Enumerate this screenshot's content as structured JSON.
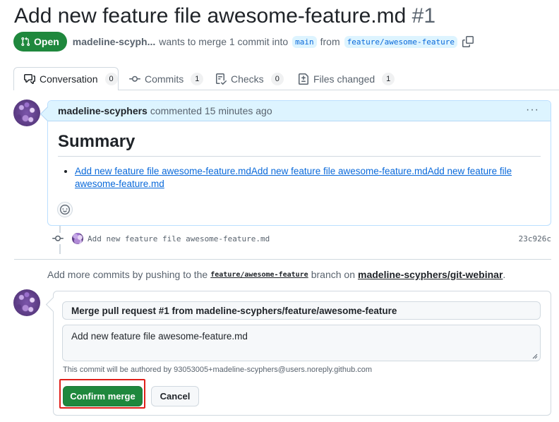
{
  "pr": {
    "title": "Add new feature file awesome-feature.md",
    "number": "#1",
    "state": "Open",
    "author": "madeline-scyph...",
    "merge_text": "wants to merge 1 commit into",
    "base_branch": "main",
    "from_text": "from",
    "head_branch": "feature/awesome-feature"
  },
  "tabs": [
    {
      "label": "Conversation",
      "count": "0",
      "icon": "comment-discussion-icon"
    },
    {
      "label": "Commits",
      "count": "1",
      "icon": "git-commit-icon"
    },
    {
      "label": "Checks",
      "count": "0",
      "icon": "checklist-icon"
    },
    {
      "label": "Files changed",
      "count": "1",
      "icon": "file-diff-icon"
    }
  ],
  "comment": {
    "author": "madeline-scyphers",
    "meta": "commented 15 minutes ago",
    "heading": "Summary",
    "list_item": "Add new feature file awesome-feature.mdAdd new feature file awesome-feature.mdAdd new feature file awesome-feature.md"
  },
  "commit": {
    "message": "Add new feature file awesome-feature.md",
    "sha": "23c926c"
  },
  "push_note": {
    "prefix": "Add more commits by pushing to the",
    "branch": "feature/awesome-feature",
    "middle": "branch on",
    "repo": "madeline-scyphers/git-webinar",
    "suffix": "."
  },
  "merge": {
    "commit_title": "Merge pull request #1 from madeline-scyphers/feature/awesome-feature",
    "commit_body": "Add new feature file awesome-feature.md",
    "author_note": "This commit will be authored by 93053005+madeline-scyphers@users.noreply.github.com",
    "confirm_label": "Confirm merge",
    "cancel_label": "Cancel"
  },
  "colors": {
    "open_green": "#1f883d",
    "link_blue": "#0969da",
    "highlight_red": "#e0201a",
    "comment_header_bg": "#ddf4ff"
  }
}
